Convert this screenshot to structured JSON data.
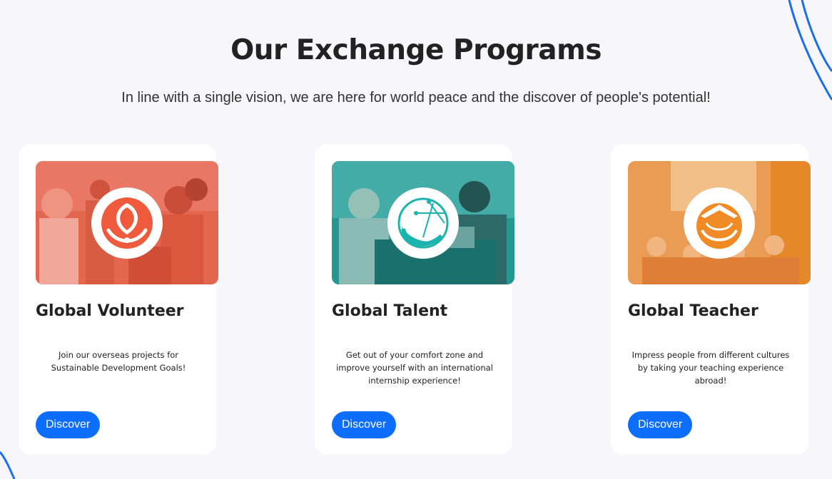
{
  "header": {
    "title": "Our Exchange Programs",
    "subtitle": "In line with a single vision, we are here for world peace and the discover of people's potential!"
  },
  "colors": {
    "accent_blue": "#0d6efd",
    "volunteer": "#f05a3c",
    "talent": "#1ab3ad",
    "teacher": "#f08a24"
  },
  "programs": [
    {
      "title": "Global Volunteer",
      "description": "Join our overseas projects for Sustainable Development Goals!",
      "button": "Discover",
      "icon": "global-volunteer-logo-icon",
      "color": "#f05a3c"
    },
    {
      "title": "Global Talent",
      "description": "Get out of your comfort zone and improve yourself with an international internship experience!",
      "button": "Discover",
      "icon": "global-talent-logo-icon",
      "color": "#1ab3ad"
    },
    {
      "title": "Global Teacher",
      "description": "Impress people from different cultures by taking your teaching experience abroad!",
      "button": "Discover",
      "icon": "global-teacher-logo-icon",
      "color": "#f08a24"
    }
  ]
}
